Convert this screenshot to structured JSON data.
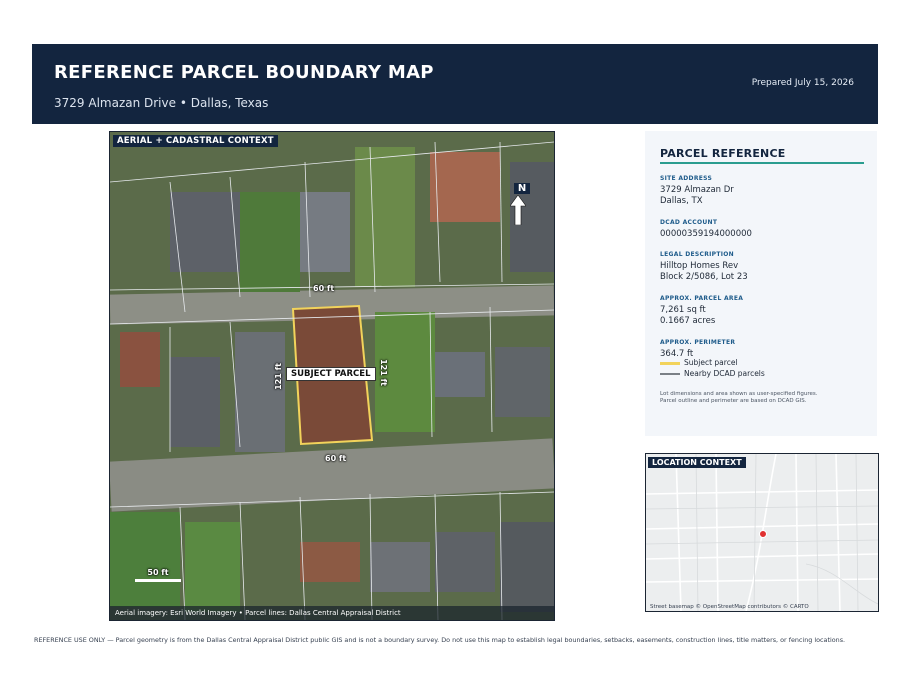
{
  "header": {
    "title": "REFERENCE PARCEL BOUNDARY MAP",
    "subtitle": "3729 Almazan Drive  •  Dallas, Texas",
    "prepared": "Prepared July 15, 2026"
  },
  "map": {
    "context_label": "AERIAL + CADASTRAL CONTEXT",
    "north_label": "N",
    "subject_label": "SUBJECT PARCEL",
    "dimensions": {
      "top": "60 ft",
      "bottom": "60 ft",
      "left": "121 ft",
      "right": "121 ft"
    },
    "scale_label": "50 ft",
    "credit": "Aerial imagery: Esri World Imagery  •  Parcel lines: Dallas Central Appraisal District",
    "colors": {
      "subject_outline": "#f2d35b",
      "parcel_lines": "#e6e9ec"
    }
  },
  "panel": {
    "title": "PARCEL REFERENCE",
    "site_address_key": "SITE ADDRESS",
    "site_address_line1": "3729 Almazan Dr",
    "site_address_line2": "Dallas, TX",
    "account_key": "DCAD ACCOUNT",
    "account_value": "00000359194000000",
    "legal_key": "LEGAL DESCRIPTION",
    "legal_line1": "Hilltop Homes Rev",
    "legal_line2": "Block 2/5086, Lot 23",
    "area_key": "APPROX. PARCEL AREA",
    "area_line1": "7,261 sq ft",
    "area_line2": "0.1667 acres",
    "perimeter_key": "APPROX. PERIMETER",
    "perimeter_value": "364.7 ft",
    "legend_subject": "Subject parcel",
    "legend_nearby": "Nearby DCAD parcels",
    "note_line1": "Lot dimensions and area shown as user-specified figures.",
    "note_line2": "Parcel outline and perimeter are based on DCAD GIS.",
    "accent": "#2a9d8f"
  },
  "location": {
    "label": "LOCATION CONTEXT",
    "credit": "Street basemap © OpenStreetMap contributors © CARTO",
    "marker_color": "#e03131"
  },
  "disclaimer": "REFERENCE USE ONLY — Parcel geometry is from the Dallas Central Appraisal District public GIS and is not a boundary survey. Do not use this map to establish legal boundaries, setbacks, easements, construction lines, title matters, or fencing locations."
}
